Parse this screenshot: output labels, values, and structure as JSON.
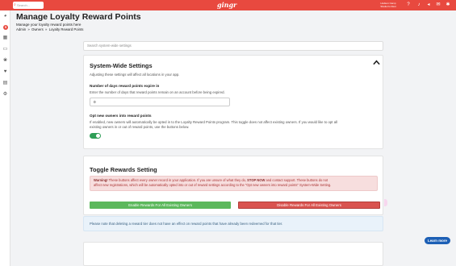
{
  "topbar": {
    "search_placeholder": "Search...",
    "logo": "gingr",
    "user_line1": "Hudson Camp",
    "user_line2": "Shelton's Rest",
    "icons": [
      "help-icon",
      "bell-icon",
      "megaphone-icon",
      "chat-icon",
      "gear-icon"
    ]
  },
  "sidebar": {
    "badge": "5",
    "icons": [
      "dashboard-icon",
      "alert-icon",
      "calendar-icon",
      "id-card-icon",
      "paw-icon",
      "heart-icon",
      "clipboard-icon",
      "settings-icon"
    ]
  },
  "header": {
    "title": "Manage Loyalty Reward Points",
    "subtitle": "Manage your loyalty reward points here",
    "breadcrumbs": [
      "Admin",
      "»",
      "Owners",
      "»",
      "Loyalty Reward Points"
    ]
  },
  "search": {
    "placeholder": "Search system-wide settings"
  },
  "system_settings": {
    "title": "System-Wide Settings",
    "description": "Adjusting these settings will affect all locations in your app.",
    "expire_label": "Number of days reward points expire in",
    "expire_help": "Enter the number of days that reward points remain on an account before being expired.",
    "expire_value": "0",
    "optin_label": "Opt new owners into reward points",
    "optin_help_line1": "If enabled, new owners will automatically be opted in to the Loyalty Reward Points program. This toggle does not affect existing owners. If you would like to opt all",
    "optin_help_line2": "existing owners in or out of reward points, use the buttons below.",
    "optin_enabled": true
  },
  "toggle_rewards": {
    "title": "Toggle Rewards Setting",
    "warning_strong": "Warning!",
    "warning_text1": " These buttons affect every owner record in your application. If you are unsure of what they do, ",
    "warning_strong2": "STOP NOW",
    "warning_text2": " and contact support. These buttons do not",
    "warning_line2": "affect new registrations, which will be automatically opted into or out of reward settings according to the \"Opt new owners into reward points\" System-Wide Setting.",
    "enable_button": "Enable Rewards For All Existing Owners",
    "disable_button": "Disable Rewards For All Existing Owners"
  },
  "info": {
    "text": "Please note that deleting a reward tier does not have an effect on reward points that have already been redeemed for that tier."
  },
  "learn_more": "Learn more",
  "colors": {
    "brand": "#e8493f",
    "enable": "#5cb85c",
    "disable": "#d9534f",
    "toggle_on": "#2f9e57",
    "learn_more": "#1d5fb5"
  }
}
